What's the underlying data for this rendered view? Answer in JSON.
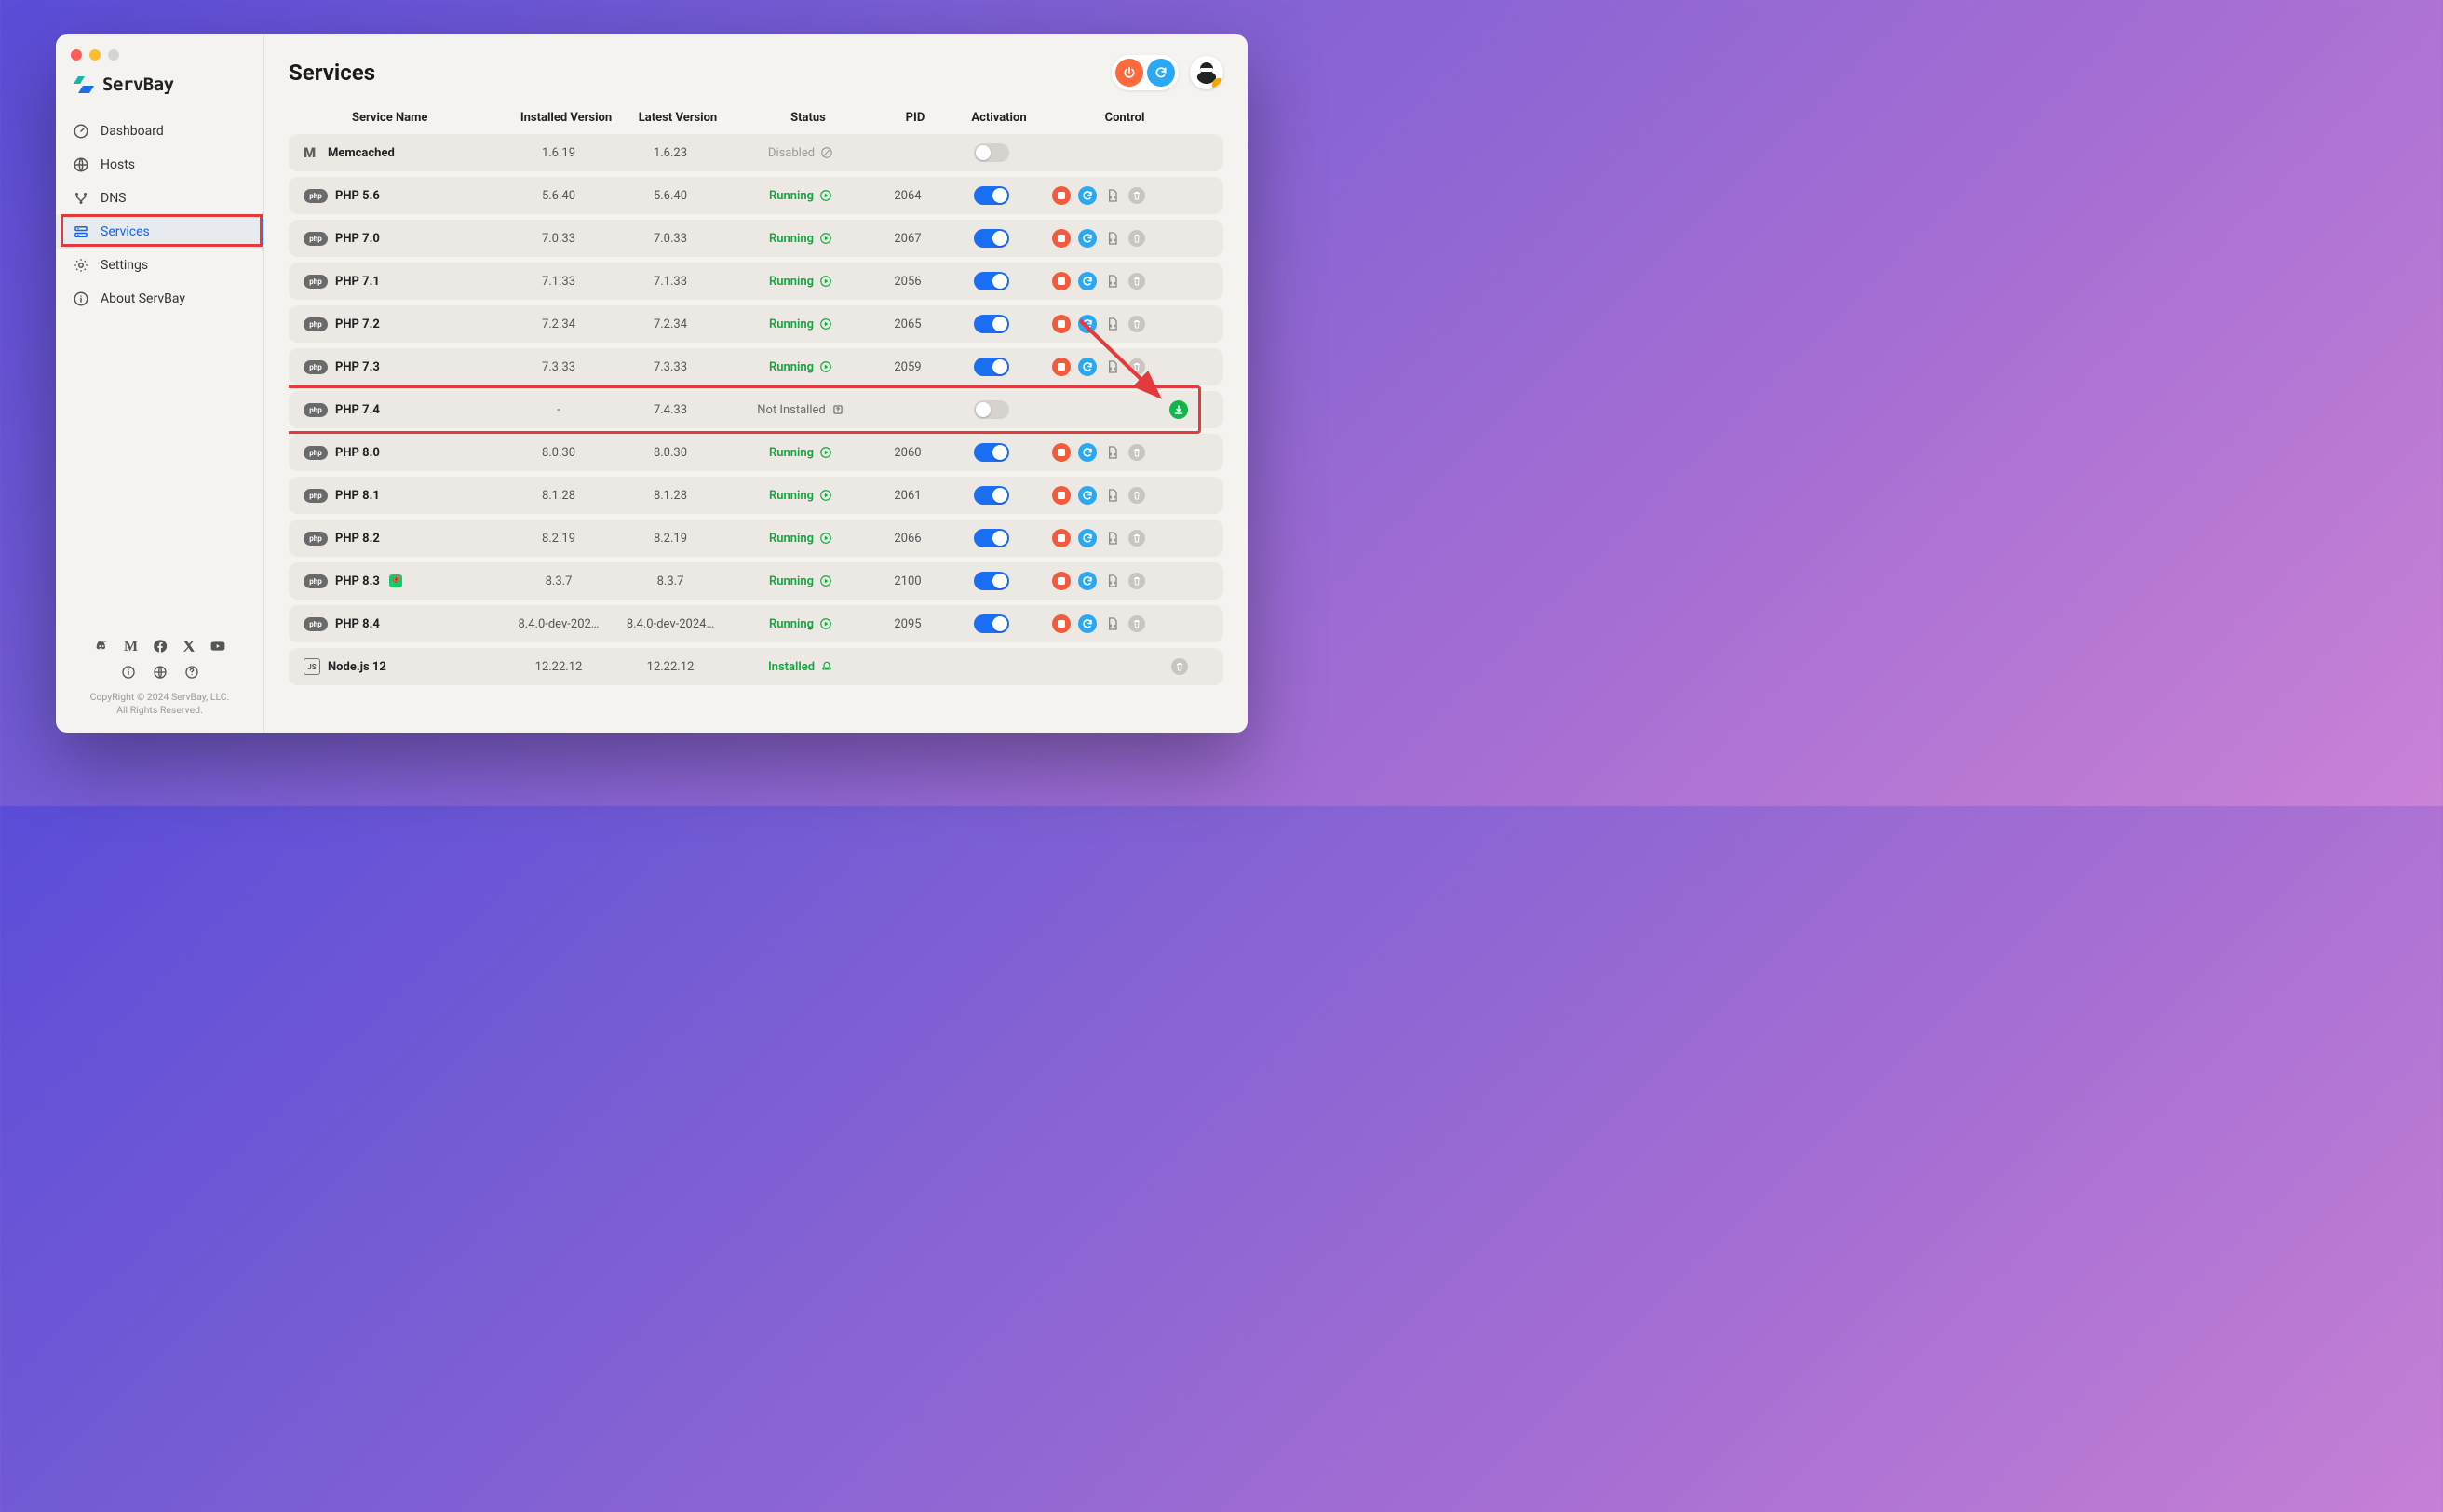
{
  "app": {
    "name": "ServBay"
  },
  "sidebar": {
    "items": [
      {
        "label": "Dashboard",
        "icon": "gauge"
      },
      {
        "label": "Hosts",
        "icon": "globe"
      },
      {
        "label": "DNS",
        "icon": "route"
      },
      {
        "label": "Services",
        "icon": "server",
        "active": true
      },
      {
        "label": "Settings",
        "icon": "gear"
      },
      {
        "label": "About ServBay",
        "icon": "info"
      }
    ],
    "copyright_line1": "CopyRight © 2024 ServBay, LLC.",
    "copyright_line2": "All Rights Reserved."
  },
  "page": {
    "title": "Services",
    "columns": [
      "Service Name",
      "Installed Version",
      "Latest Version",
      "Status",
      "PID",
      "Activation",
      "Control"
    ]
  },
  "services": [
    {
      "name": "Memcached",
      "icon": "M",
      "installed": "1.6.19",
      "latest": "1.6.23",
      "status": "Disabled",
      "pid": "",
      "toggle": false,
      "controls": []
    },
    {
      "name": "PHP 5.6",
      "icon": "php",
      "installed": "5.6.40",
      "latest": "5.6.40",
      "status": "Running",
      "pid": "2064",
      "toggle": true,
      "controls": [
        "stop",
        "reload",
        "file",
        "trash"
      ]
    },
    {
      "name": "PHP 7.0",
      "icon": "php",
      "installed": "7.0.33",
      "latest": "7.0.33",
      "status": "Running",
      "pid": "2067",
      "toggle": true,
      "controls": [
        "stop",
        "reload",
        "file",
        "trash"
      ]
    },
    {
      "name": "PHP 7.1",
      "icon": "php",
      "installed": "7.1.33",
      "latest": "7.1.33",
      "status": "Running",
      "pid": "2056",
      "toggle": true,
      "controls": [
        "stop",
        "reload",
        "file",
        "trash"
      ]
    },
    {
      "name": "PHP 7.2",
      "icon": "php",
      "installed": "7.2.34",
      "latest": "7.2.34",
      "status": "Running",
      "pid": "2065",
      "toggle": true,
      "controls": [
        "stop",
        "reload",
        "file",
        "trash"
      ]
    },
    {
      "name": "PHP 7.3",
      "icon": "php",
      "installed": "7.3.33",
      "latest": "7.3.33",
      "status": "Running",
      "pid": "2059",
      "toggle": true,
      "controls": [
        "stop",
        "reload",
        "file",
        "trash"
      ]
    },
    {
      "name": "PHP 7.4",
      "icon": "php",
      "installed": "-",
      "latest": "7.4.33",
      "status": "Not Installed",
      "pid": "",
      "toggle": false,
      "controls": [
        "download"
      ],
      "highlight": true
    },
    {
      "name": "PHP 8.0",
      "icon": "php",
      "installed": "8.0.30",
      "latest": "8.0.30",
      "status": "Running",
      "pid": "2060",
      "toggle": true,
      "controls": [
        "stop",
        "reload",
        "file",
        "trash"
      ]
    },
    {
      "name": "PHP 8.1",
      "icon": "php",
      "installed": "8.1.28",
      "latest": "8.1.28",
      "status": "Running",
      "pid": "2061",
      "toggle": true,
      "controls": [
        "stop",
        "reload",
        "file",
        "trash"
      ]
    },
    {
      "name": "PHP 8.2",
      "icon": "php",
      "installed": "8.2.19",
      "latest": "8.2.19",
      "status": "Running",
      "pid": "2066",
      "toggle": true,
      "controls": [
        "stop",
        "reload",
        "file",
        "trash"
      ]
    },
    {
      "name": "PHP 8.3",
      "icon": "php",
      "pinned": true,
      "installed": "8.3.7",
      "latest": "8.3.7",
      "status": "Running",
      "pid": "2100",
      "toggle": true,
      "controls": [
        "stop",
        "reload",
        "file",
        "trash"
      ]
    },
    {
      "name": "PHP 8.4",
      "icon": "php",
      "installed": "8.4.0-dev-202…",
      "latest": "8.4.0-dev-2024…",
      "status": "Running",
      "pid": "2095",
      "toggle": true,
      "controls": [
        "stop",
        "reload",
        "file",
        "trash"
      ]
    },
    {
      "name": "Node.js 12",
      "icon": "node",
      "installed": "12.22.12",
      "latest": "12.22.12",
      "status": "Installed",
      "pid": "",
      "toggle": null,
      "controls": [
        "trash-right"
      ]
    }
  ]
}
